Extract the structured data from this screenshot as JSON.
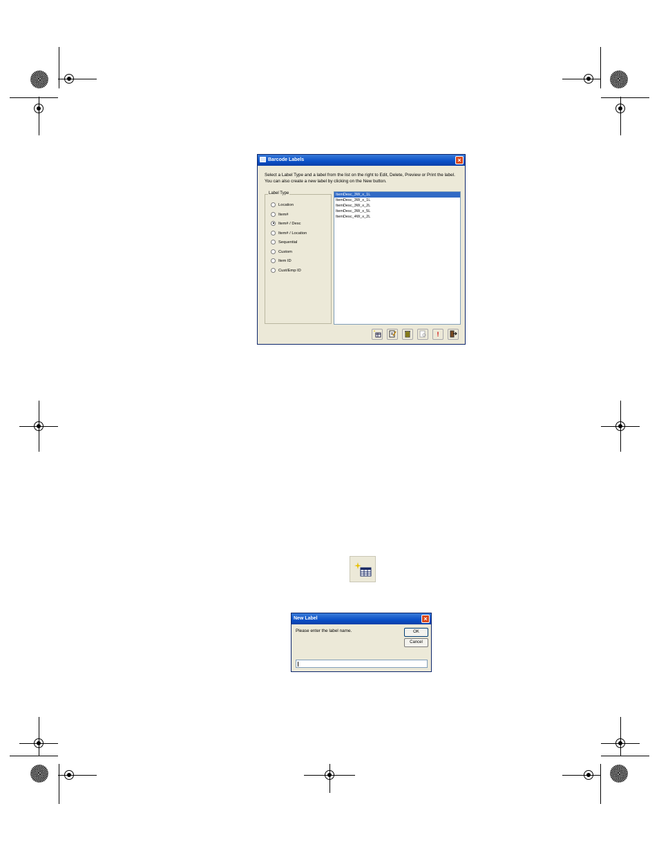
{
  "barcode_dialog": {
    "title": "Barcode Labels",
    "instruction": "Select a Label Type and a label from the list on the right to Edit, Delete, Preview or Print the label. You can also create a new label by clicking on the New button.",
    "group_label": "Label Type",
    "label_types": [
      {
        "label": "Location",
        "checked": false
      },
      {
        "label": "Item#",
        "checked": false
      },
      {
        "label": "Item# / Desc",
        "checked": true
      },
      {
        "label": "Item# / Location",
        "checked": false
      },
      {
        "label": "Sequential",
        "checked": false
      },
      {
        "label": "Custom",
        "checked": false
      },
      {
        "label": "Item ID",
        "checked": false
      },
      {
        "label": "Cust/Emp ID",
        "checked": false
      }
    ],
    "labels_list": [
      {
        "label": "ItemDesc_3W_x_1L",
        "selected": true
      },
      {
        "label": "ItemDesc_3W_x_1L",
        "selected": false
      },
      {
        "label": "ItemDesc_3W_x_2L",
        "selected": false
      },
      {
        "label": "ItemDesc_3W_x_5L",
        "selected": false
      },
      {
        "label": "ItemDesc_4W_x_2L",
        "selected": false
      }
    ],
    "toolbar_icons": [
      "new-label-icon",
      "edit-icon",
      "delete-icon",
      "preview-icon",
      "print-icon",
      "exit-icon"
    ]
  },
  "new_label_icon": "new-label-icon",
  "new_label_dialog": {
    "title": "New Label",
    "prompt": "Please enter the label name.",
    "ok_label": "OK",
    "cancel_label": "Cancel",
    "input_value": ""
  }
}
